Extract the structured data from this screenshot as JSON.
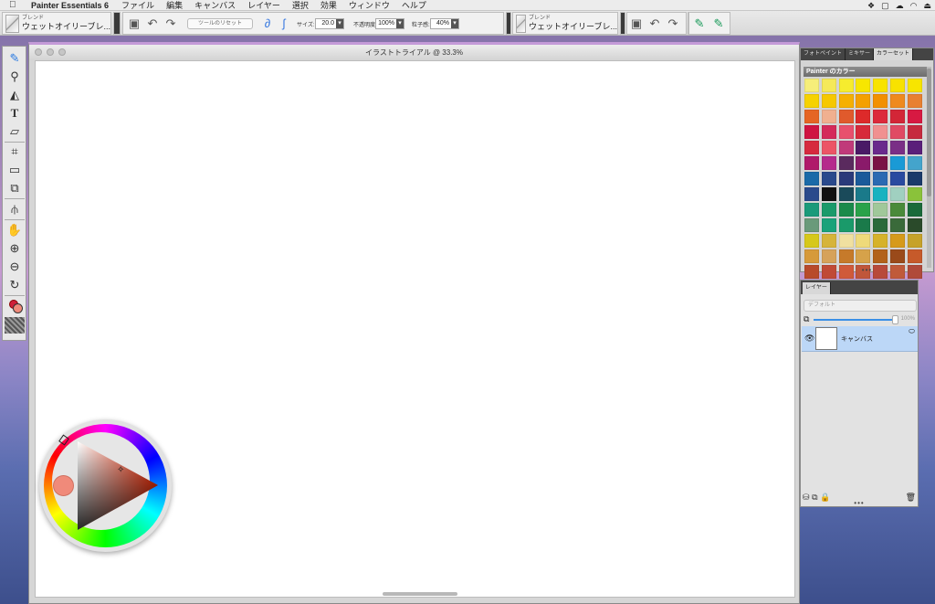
{
  "menubar": {
    "apple": "",
    "app_name": "Painter Essentials 6",
    "items": [
      "ファイル",
      "編集",
      "キャンバス",
      "レイヤー",
      "選択",
      "効果",
      "ウィンドウ",
      "ヘルプ"
    ]
  },
  "propbar": {
    "brush1": {
      "category": "ブレンド",
      "name": "ウェットオイリーブレ..."
    },
    "reset_label": "ツールのリセット",
    "size_label": "サイズ:",
    "size_value": "20.0",
    "opacity_label": "不透明度:",
    "opacity_value": "100%",
    "grain_label": "粒子感:",
    "grain_value": "40%",
    "brush2": {
      "category": "ブレンド",
      "name": "ウェットオイリーブレ..."
    }
  },
  "document": {
    "title": "イラストトライアル @ 33.3%"
  },
  "colorwheel": {
    "current_color": "#f08a7a"
  },
  "color_panel": {
    "tabs": [
      "フォトペイント",
      "ミキサー",
      "カラーセット"
    ],
    "active_tab": 2,
    "header": "Painter のカラー",
    "swatches": [
      "#f6ee7a",
      "#f5e95a",
      "#f6ec2e",
      "#f7e600",
      "#f8e300",
      "#f8e200",
      "#f7e500",
      "#f6d200",
      "#f6c800",
      "#f5b000",
      "#f4a000",
      "#f29000",
      "#ef8a1e",
      "#e88031",
      "#e56524",
      "#f0b090",
      "#e05a2c",
      "#dd2a2a",
      "#dc2a3b",
      "#d32637",
      "#d71942",
      "#cf1442",
      "#d42a5a",
      "#e8506d",
      "#d72a3a",
      "#f09090",
      "#e04a64",
      "#c62a3e",
      "#d62a3e",
      "#ec5566",
      "#c03a7a",
      "#4a1a66",
      "#6a2a8c",
      "#7a2e86",
      "#5a1f7a",
      "#b01a6a",
      "#b52a8c",
      "#5a2a5e",
      "#8a1a6a",
      "#7a1245",
      "#1a9ad6",
      "#44a4cc",
      "#1a6aa8",
      "#2a4a8c",
      "#2a3a7a",
      "#1a5a9a",
      "#2a6ab2",
      "#2a4aa0",
      "#1a3a6a",
      "#2a4a8c",
      "#111111",
      "#1a4a5a",
      "#1a7a8a",
      "#1ab2c0",
      "#a0d0c0",
      "#8ac23a",
      "#1a9a7a",
      "#1a9a6a",
      "#1a8a4a",
      "#2aa24a",
      "#a0c89a",
      "#4a8a3a",
      "#1a6a3a",
      "#6a9a7a",
      "#1aa27a",
      "#1a9a6a",
      "#1a7a4a",
      "#2a6a3a",
      "#3a6a3a",
      "#2a4a2a",
      "#d6c81a",
      "#d6b43a",
      "#f0e0a0",
      "#eeda7a",
      "#d6b22a",
      "#d69a1a",
      "#c6a22a",
      "#d69a3a",
      "#d6a25a",
      "#c67a2a",
      "#d6a24a",
      "#b2621a",
      "#9a4a1a",
      "#c65a2a",
      "#b84a2a",
      "#c04a36",
      "#d05a3a",
      "#c0563a",
      "#b84a3a",
      "#c05a3a",
      "#b04a3a"
    ]
  },
  "layer_panel": {
    "tab": "レイヤー",
    "composite_method": "デフォルト",
    "opacity_value": "100%",
    "layers": [
      {
        "name": "キャンバス"
      }
    ]
  }
}
